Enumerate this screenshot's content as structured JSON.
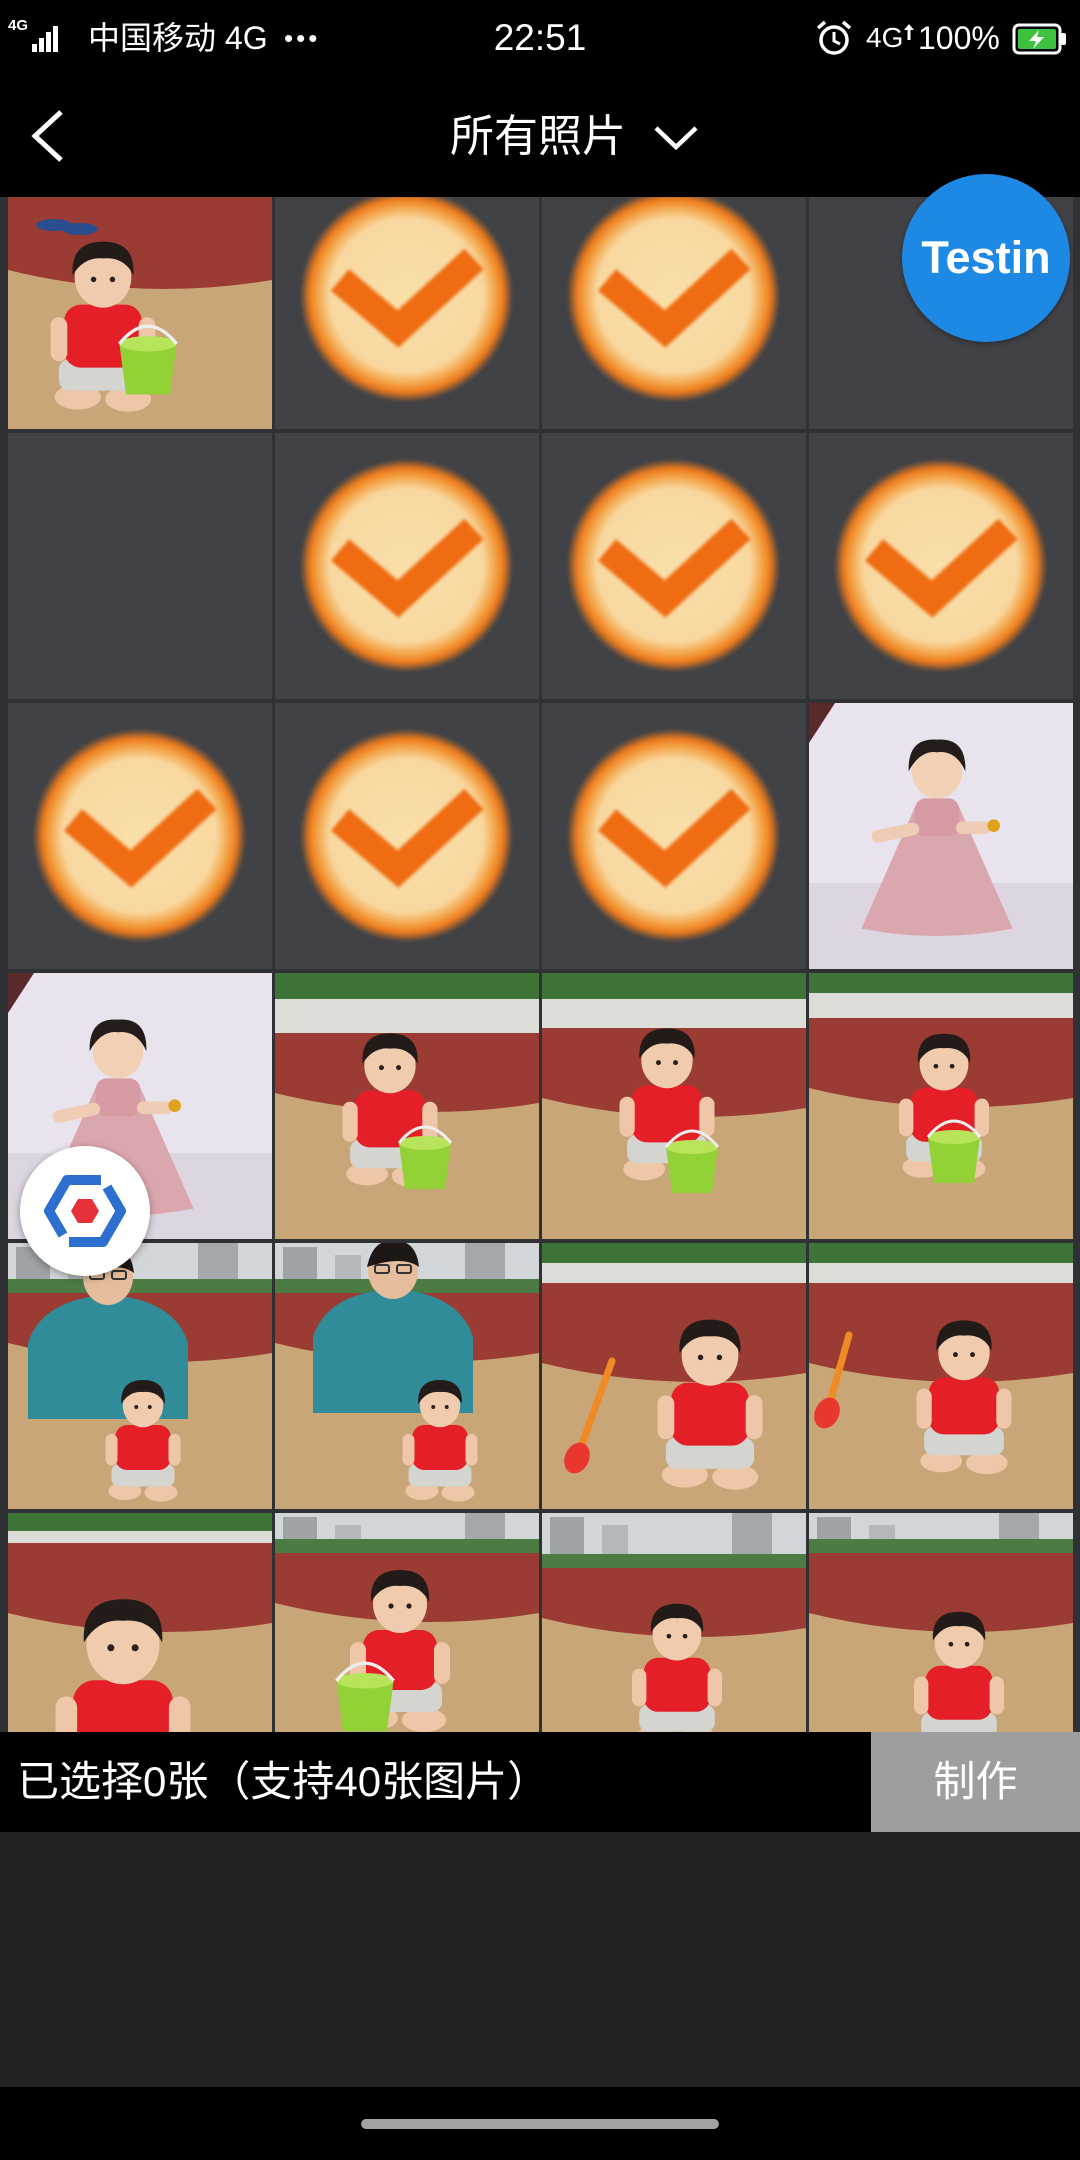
{
  "status_bar": {
    "signal_label": "4G",
    "carrier": "中国移动 4G",
    "more": "•••",
    "time": "22:51",
    "network": "4G",
    "battery": "100%",
    "icons": {
      "signal": "cellular-signal-icon",
      "alarm": "alarm-clock-icon",
      "upload": "data-up-arrow-icon",
      "battery": "battery-charging-icon"
    }
  },
  "header": {
    "title": "所有照片",
    "back_icon": "back-chevron-icon",
    "dropdown_icon": "chevron-down-icon"
  },
  "grid": {
    "columns": 4,
    "cells": [
      {
        "photo": true
      },
      {
        "icon": "checkmark-icon"
      },
      {
        "icon": "checkmark-icon"
      },
      {
        "empty": true
      },
      {
        "empty": true
      },
      {
        "icon": "checkmark-icon"
      },
      {
        "icon": "checkmark-icon"
      },
      {
        "icon": "checkmark-icon"
      },
      {
        "icon": "checkmark-icon"
      },
      {
        "icon": "checkmark-icon"
      },
      {
        "icon": "checkmark-icon"
      },
      {
        "photo": true
      },
      {
        "photo": true
      },
      {
        "photo": true
      },
      {
        "photo": true
      },
      {
        "photo": true
      },
      {
        "photo": true
      },
      {
        "photo": true
      },
      {
        "photo": true
      },
      {
        "photo": true
      },
      {
        "photo": true
      },
      {
        "photo": true
      },
      {
        "photo": true
      },
      {
        "photo": true
      }
    ]
  },
  "bottom_bar": {
    "selection_text": "已选择0张（支持40张图片）",
    "make_button": "制作"
  },
  "floating": {
    "testin_label": "Testin",
    "logo_icon": "hexagon-logo-icon"
  },
  "colors": {
    "accent_blue": "#1e88e5",
    "check_orange": "#ef6c12",
    "button_gray": "#9e9e9e",
    "battery_green": "#3cc23c"
  }
}
